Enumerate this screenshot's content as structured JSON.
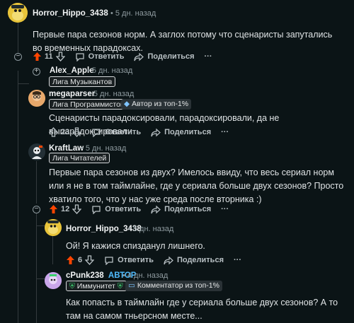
{
  "comments": [
    {
      "username": "Horror_Hippo_3438",
      "time": "5 дн. назад",
      "body": "Первые пара сезонов норм. А заглох потому что сценаристы запутались во временных парадоксах.",
      "votes": "11",
      "reply_label": "Ответить",
      "share_label": "Поделиться",
      "more_label": "···"
    },
    {
      "username": "Alex_Apple",
      "time": "5 дн. назад",
      "flair": "Лига Музыкантов"
    },
    {
      "username": "megaparser",
      "time": "5 дн. назад",
      "flair": "Лига Программистов",
      "flair2": "Автор из топ-1%",
      "body": "Сценаристы парадоксировали, парадоксировали, да не выпарадоксировали",
      "votes": "23",
      "reply_label": "Ответить",
      "share_label": "Поделиться",
      "more_label": "···"
    },
    {
      "username": "KraftLaw",
      "time": "5 дн. назад",
      "flair": "Лига Читателей",
      "body": "Первые пара сезонов из двух? Имелось ввиду, что весь сериал норм или я не в том таймлайне, где у сериала больше двух сезонов? Просто хватило того, что у нас уже среда после вторника :)",
      "votes": "12",
      "reply_label": "Ответить",
      "share_label": "Поделиться",
      "more_label": "···"
    },
    {
      "username": "Horror_Hippo_3438",
      "time": "5 дн. назад",
      "body": "Ой! Я кажися спизданул лишнего.",
      "votes": "6",
      "reply_label": "Ответить",
      "share_label": "Поделиться",
      "more_label": "···"
    },
    {
      "username": "cPunk238",
      "author_badge": "АВТОР",
      "time": "4 дн. назад",
      "flair": "Иммунитет",
      "flair2": "Комментатор из топ-1%",
      "body": "Как попасть в таймлайн где у сериала больше двух сезонов? А то там на самом тньерсном месте..."
    }
  ],
  "colors": {
    "upvote_active": "#ff4500",
    "author": "#4fbcff",
    "background": "#0b1416"
  }
}
